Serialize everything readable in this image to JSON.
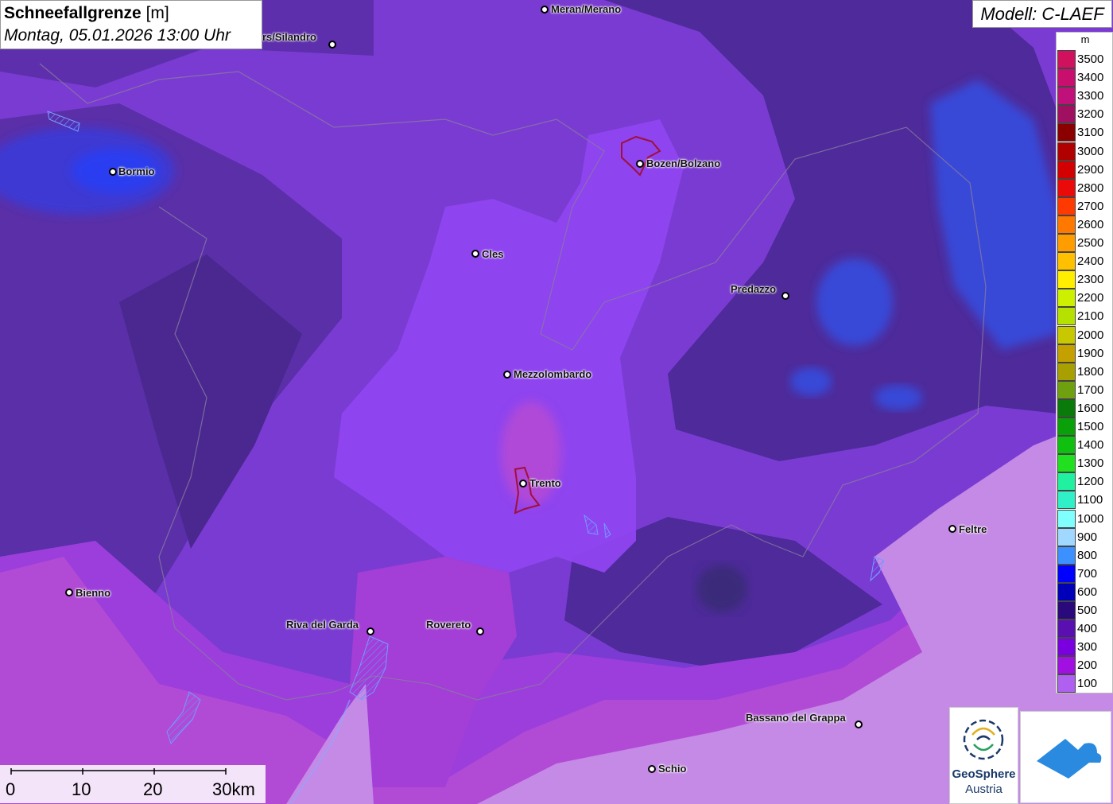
{
  "title": {
    "param": "Schneefallgrenze",
    "unit": "[m]",
    "date": "Montag, 05.01.2026 13:00 Uhr"
  },
  "model": "Modell: C-LAEF",
  "legend": {
    "unit": "m",
    "entries": [
      {
        "label": "3500",
        "color": "#d0115e"
      },
      {
        "label": "3400",
        "color": "#c80f6e"
      },
      {
        "label": "3300",
        "color": "#c0107a"
      },
      {
        "label": "3200",
        "color": "#a01060"
      },
      {
        "label": "3100",
        "color": "#8a0000"
      },
      {
        "label": "3000",
        "color": "#b00000"
      },
      {
        "label": "2900",
        "color": "#d20000"
      },
      {
        "label": "2800",
        "color": "#ea0a0a"
      },
      {
        "label": "2700",
        "color": "#ff3a00"
      },
      {
        "label": "2600",
        "color": "#ff7800"
      },
      {
        "label": "2500",
        "color": "#ff9c00"
      },
      {
        "label": "2400",
        "color": "#ffc000"
      },
      {
        "label": "2300",
        "color": "#ffee00"
      },
      {
        "label": "2200",
        "color": "#ccf000"
      },
      {
        "label": "2100",
        "color": "#b6e000"
      },
      {
        "label": "2000",
        "color": "#c8c800"
      },
      {
        "label": "1900",
        "color": "#c4a000"
      },
      {
        "label": "1800",
        "color": "#a8a000"
      },
      {
        "label": "1700",
        "color": "#6ea010"
      },
      {
        "label": "1600",
        "color": "#0a7a0a"
      },
      {
        "label": "1500",
        "color": "#0aa00a"
      },
      {
        "label": "1400",
        "color": "#10c010"
      },
      {
        "label": "1300",
        "color": "#20e020"
      },
      {
        "label": "1200",
        "color": "#20f0a0"
      },
      {
        "label": "1100",
        "color": "#30f0c8"
      },
      {
        "label": "1000",
        "color": "#80ffff"
      },
      {
        "label": "900",
        "color": "#a0d8ff"
      },
      {
        "label": "800",
        "color": "#3c90ff"
      },
      {
        "label": "700",
        "color": "#0000ff"
      },
      {
        "label": "600",
        "color": "#0000b8"
      },
      {
        "label": "500",
        "color": "#2a0a7a"
      },
      {
        "label": "400",
        "color": "#5a10b0"
      },
      {
        "label": "300",
        "color": "#7a00e0"
      },
      {
        "label": "200",
        "color": "#a010e0"
      },
      {
        "label": "100",
        "color": "#b060f0"
      }
    ]
  },
  "cities": [
    {
      "name": "Meran/Merano"
    },
    {
      "name": "rs/Silandro"
    },
    {
      "name": "Bormio"
    },
    {
      "name": "Bozen/Bolzano"
    },
    {
      "name": "Cles"
    },
    {
      "name": "Predazzo"
    },
    {
      "name": "Mezzolombardo"
    },
    {
      "name": "Trento"
    },
    {
      "name": "Feltre"
    },
    {
      "name": "Bienno"
    },
    {
      "name": "Riva del Garda"
    },
    {
      "name": "Rovereto"
    },
    {
      "name": "Bassano del Grappa"
    },
    {
      "name": "Schio"
    }
  ],
  "scale": {
    "labels": [
      "0",
      "10",
      "20",
      "30km"
    ]
  },
  "logos": {
    "geosphere_line1": "GeoSphere",
    "geosphere_line2": "Austria"
  }
}
